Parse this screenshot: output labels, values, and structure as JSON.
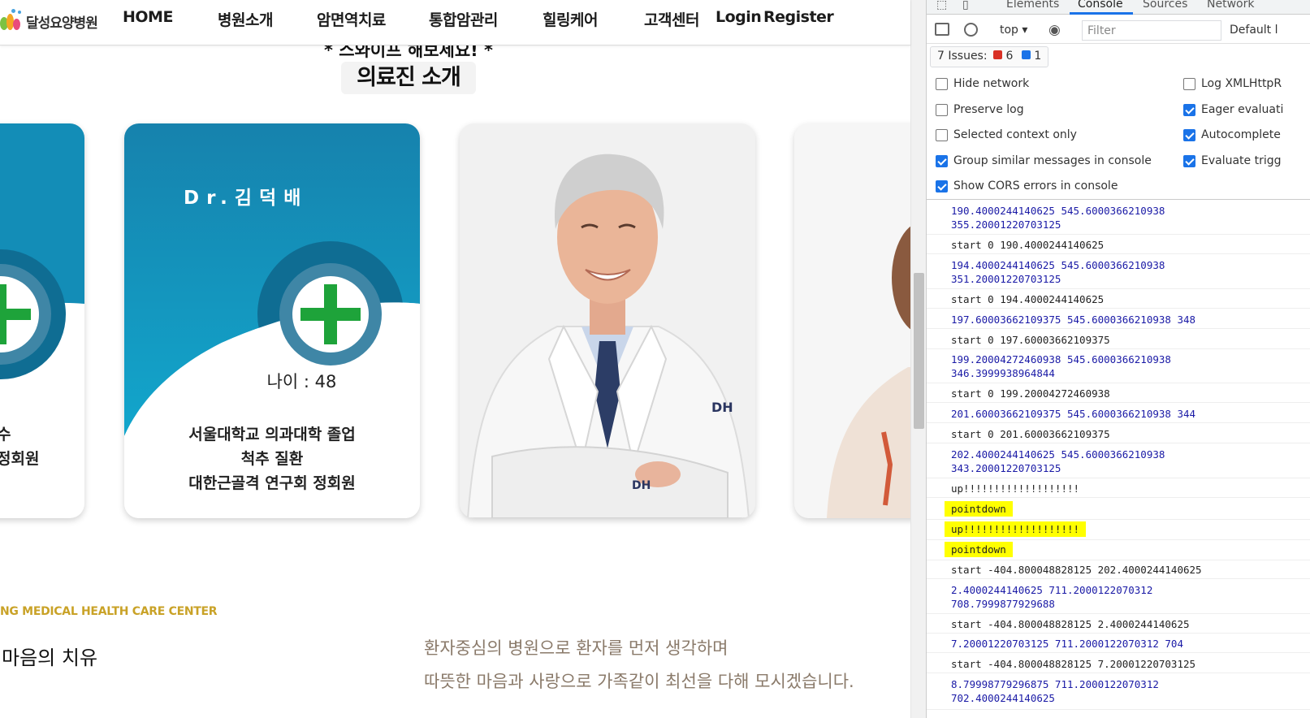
{
  "site": {
    "logo_text": "달성요양병원",
    "nav": [
      "HOME",
      "병원소개",
      "암면역치료",
      "통합암관리",
      "힐링케어",
      "고객센터",
      "Login",
      "Register"
    ],
    "swipe_hint": "* 스와이프 해보세요! *",
    "section_title": "의료진 소개",
    "cards": [
      {
        "partial_lines": [
          "수",
          "정회원"
        ]
      },
      {
        "name": "Dr.김덕배",
        "age": "나이 : 48",
        "lines": [
          "서울대학교 의과대학 졸업",
          "척추 질환",
          "대한근골격 연구회 정회원"
        ]
      }
    ],
    "photo_badge": "DH",
    "center_en": "NG MEDICAL HEALTH CARE CENTER",
    "center_ko": "마음의 치유",
    "desc_lines": [
      "환자중심의 병원으로 환자를 먼저 생각하며",
      "따뜻한 마음과 사랑으로 가족같이 최선을 다해 모시겠습니다."
    ],
    "colors": {
      "card_teal": "#1389b4",
      "cross_green": "#1ea33a",
      "ring_blue": "#3f86a6",
      "accent_gold": "#c9a227"
    }
  },
  "devtools": {
    "tabs": [
      "Elements",
      "Console",
      "Sources",
      "Network"
    ],
    "active_tab": "Console",
    "context": "top",
    "filter_placeholder": "Filter",
    "levels": "Default l",
    "issues": {
      "label": "7 Issues:",
      "errors": "6",
      "info": "1"
    },
    "settings": [
      {
        "label": "Hide network",
        "checked": false
      },
      {
        "label": "Preserve log",
        "checked": false
      },
      {
        "label": "Selected context only",
        "checked": false
      },
      {
        "label": "Group similar messages in console",
        "checked": true
      },
      {
        "label": "Show CORS errors in console",
        "checked": true
      },
      {
        "label": "Log XMLHttpR",
        "checked": false
      },
      {
        "label": "Eager evaluati",
        "checked": true
      },
      {
        "label": "Autocomplete",
        "checked": true
      },
      {
        "label": "Evaluate trigg",
        "checked": true
      }
    ],
    "logs": [
      "190.4000244140625 545.6000366210938\n355.20001220703125",
      "start 0 190.4000244140625",
      "194.4000244140625 545.6000366210938\n351.20001220703125",
      "start 0 194.4000244140625",
      "197.60003662109375 545.6000366210938 348",
      "start 0 197.60003662109375",
      "199.20004272460938 545.6000366210938\n346.3999938964844",
      "start 0 199.20004272460938",
      "201.60003662109375 545.6000366210938 344",
      "start 0 201.60003662109375",
      "202.4000244140625 545.6000366210938\n343.20001220703125",
      "up!!!!!!!!!!!!!!!!!!!",
      "pointdown",
      "up!!!!!!!!!!!!!!!!!!!",
      "pointdown",
      "start -404.800048828125 202.4000244140625",
      "2.4000244140625 711.2000122070312\n708.7999877929688",
      "start -404.800048828125 2.4000244140625",
      "7.20001220703125 711.2000122070312 704",
      "start -404.800048828125 7.20001220703125",
      "8.79998779296875 711.2000122070312\n702.4000244140625"
    ]
  }
}
